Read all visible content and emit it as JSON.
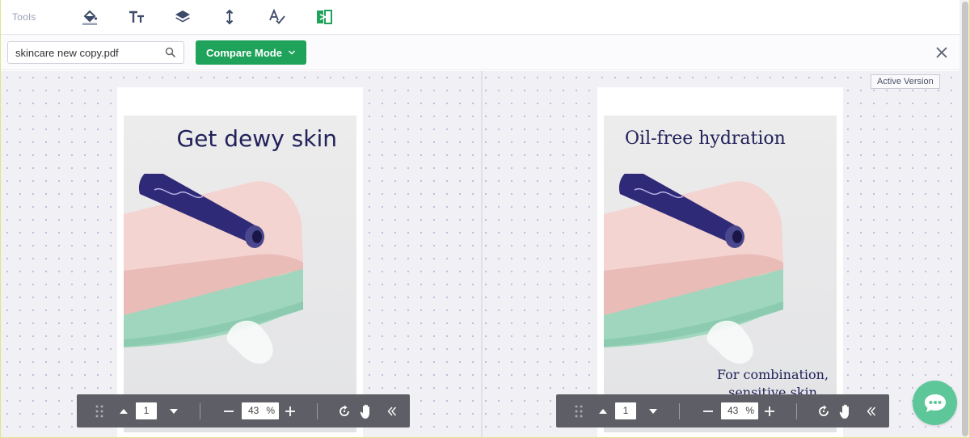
{
  "toolbar": {
    "label": "Tools",
    "icons": [
      "paint-bucket-icon",
      "text-size-icon",
      "layers-icon",
      "vertical-spacing-icon",
      "spell-check-icon",
      "compare-icon"
    ]
  },
  "search": {
    "value": "skincare new copy.pdf",
    "placeholder": ""
  },
  "compare_button": {
    "label": "Compare Mode"
  },
  "badge": {
    "label": "Active Version"
  },
  "left_page": {
    "headline": "Get dewy skin"
  },
  "right_page": {
    "headline": "Oil-free hydration",
    "subtext": "For combination, sensitive skin"
  },
  "left_controls": {
    "page": "1",
    "zoom": "43",
    "percent": "%"
  },
  "right_controls": {
    "page": "1",
    "zoom": "43",
    "percent": "%"
  },
  "colors": {
    "accent": "#1fa35b",
    "chat": "#5ec79a",
    "navy": "#22215a"
  }
}
